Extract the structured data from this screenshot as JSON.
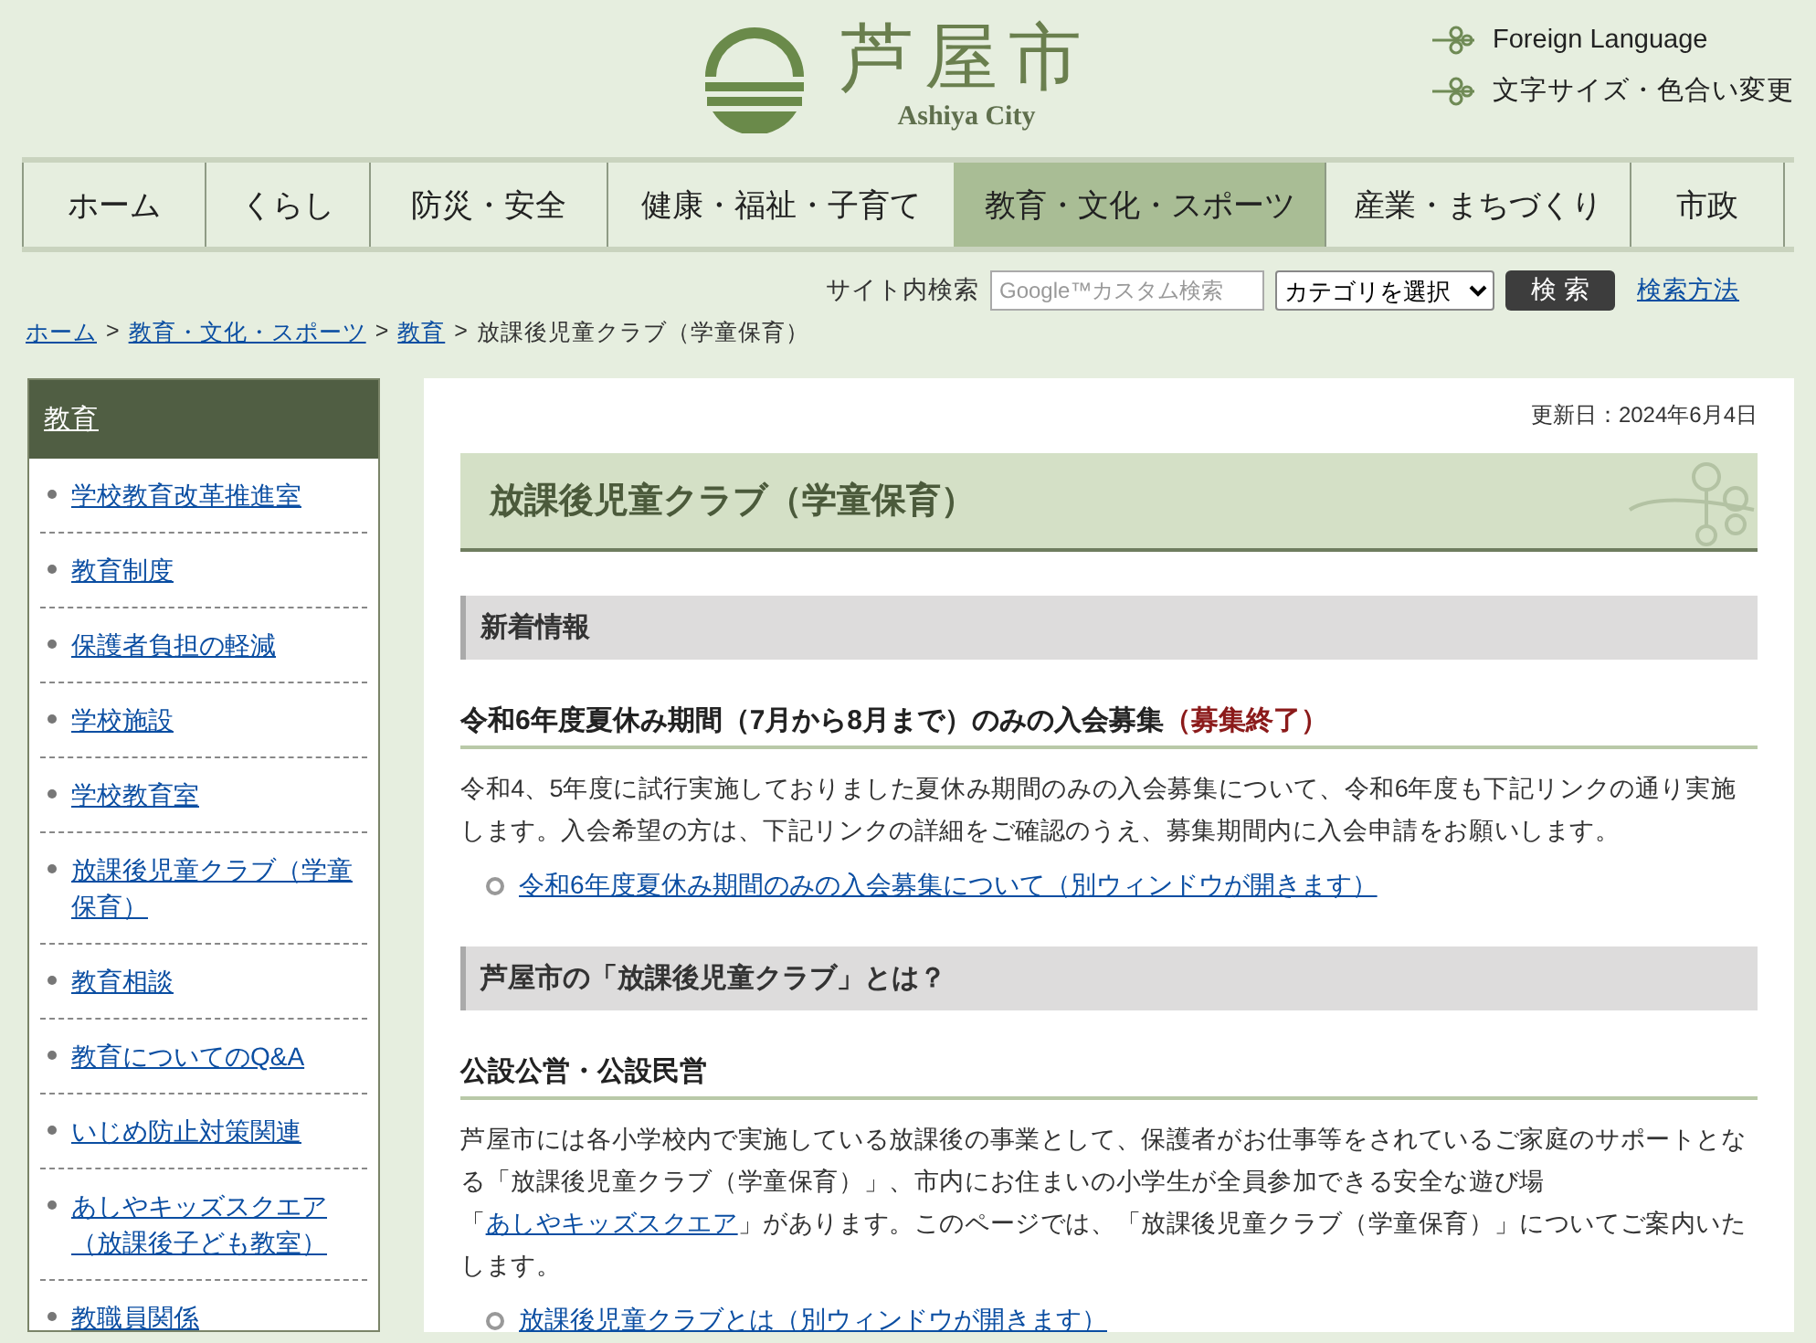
{
  "header": {
    "logo_title": "芦屋市",
    "logo_subtitle": "Ashiya City",
    "links": [
      "Foreign Language",
      "文字サイズ・色合い変更"
    ]
  },
  "nav": [
    {
      "label": "ホーム",
      "selected": false
    },
    {
      "label": "くらし",
      "selected": false
    },
    {
      "label": "防災・安全",
      "selected": false
    },
    {
      "label": "健康・福祉・子育て",
      "selected": false
    },
    {
      "label": "教育・文化・スポーツ",
      "selected": true
    },
    {
      "label": "産業・まちづくり",
      "selected": false
    },
    {
      "label": "市政",
      "selected": false
    }
  ],
  "search": {
    "label": "サイト内検索",
    "placeholder": "Google™カスタム検索",
    "category": "カテゴリを選択",
    "button": "検 索",
    "help_link": "検索方法"
  },
  "breadcrumb": [
    {
      "kind": "link",
      "text": "ホーム"
    },
    {
      "kind": "separator",
      "text": ">"
    },
    {
      "kind": "link",
      "text": "教育・文化・スポーツ"
    },
    {
      "kind": "separator",
      "text": ">"
    },
    {
      "kind": "link",
      "text": "教育"
    },
    {
      "kind": "separator",
      "text": ">"
    },
    {
      "kind": "current",
      "text": "放課後児童クラブ（学童保育）"
    }
  ],
  "sidebar": {
    "title": "教育",
    "items": [
      "学校教育改革推進室",
      "教育制度",
      "保護者負担の軽減",
      "学校施設",
      "学校教育室",
      "放課後児童クラブ（学童保育）",
      "教育相談",
      "教育についてのQ&A",
      "いじめ防止対策関連",
      "あしやキッズスクエア（放課後子ども教室）",
      "教職員関係"
    ]
  },
  "main": {
    "updated": "更新日：2024年6月4日",
    "title": "放課後児童クラブ（学童保育）",
    "blocks": [
      {
        "kind": "h2",
        "text": "新着情報"
      },
      {
        "kind": "h3",
        "text": "令和6年度夏休み期間（7月から8月まで）のみの入会募集",
        "note": "（募集終了）"
      },
      {
        "kind": "paragraph",
        "parts": [
          {
            "text": "令和4、5年度に試行実施しておりました夏休み期間のみの入会募集について、令和6年度も下記リンクの通り実施します。入会希望の方は、下記リンクの詳細をご確認のうえ、募集期間内に入会申請をお願いします。",
            "kind": "text"
          }
        ]
      },
      {
        "kind": "link_item",
        "text": "令和6年度夏休み期間のみの入会募集について（別ウィンドウが開きます）"
      },
      {
        "kind": "h2",
        "text": "芦屋市の「放課後児童クラブ」とは？"
      },
      {
        "kind": "h3",
        "text": "公設公営・公設民営"
      },
      {
        "kind": "paragraph",
        "parts": [
          {
            "text": "芦屋市には各小学校内で実施している放課後の事業として、保護者がお仕事等をされているご家庭のサポートとなる「放課後児童クラブ（学童保育）」、市内にお住まいの小学生が全員参加できる安全な遊び場「",
            "kind": "text"
          },
          {
            "text": "あしやキッズスクエア",
            "kind": "link"
          },
          {
            "text": "」があります。このページでは、「放課後児童クラブ（学童保育）」についてご案内いたします。",
            "kind": "text"
          }
        ]
      },
      {
        "kind": "link_item",
        "text": "放課後児童クラブとは（別ウィンドウが開きます）"
      }
    ]
  }
}
